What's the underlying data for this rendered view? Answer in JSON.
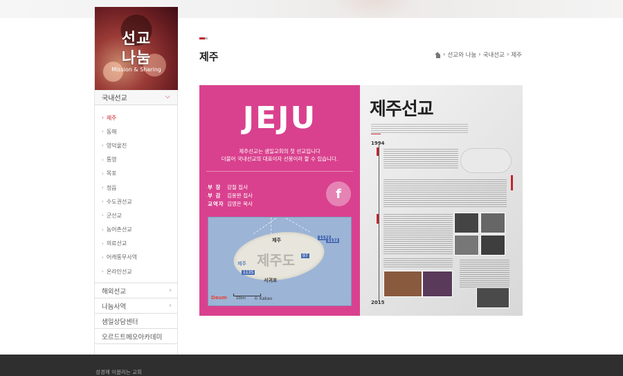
{
  "sidebar": {
    "hero": {
      "title1": "선교",
      "title2": "나눔",
      "subtitle": "Mission & Sharing"
    },
    "active_section": "국내선교",
    "submenu": [
      "제주",
      "동해",
      "영덕울진",
      "통영",
      "목포",
      "정읍",
      "수도권선교",
      "군선교",
      "농어촌선교",
      "의료선교",
      "어캐통무사역",
      "온라인선교"
    ],
    "other_sections": [
      "해외선교",
      "나눔사역",
      "샘일상담센터",
      "오르드트메오아카데미"
    ]
  },
  "main": {
    "title": "제주",
    "breadcrumb": [
      "선교와 나눔",
      "국내선교",
      "제주"
    ]
  },
  "banner": {
    "big_title": "JEJU",
    "desc_line1": "제주선교는 샘일교회의 첫 선교입니다",
    "desc_line2": "더불어 국내선교의 대표이자 선봉이라 할 수 있습니다.",
    "staff": [
      {
        "role": "부 장",
        "name": "강철 집사"
      },
      {
        "role": "부 감",
        "name": "김용완 집사"
      },
      {
        "role": "교역자",
        "name": "김영은 목사"
      }
    ],
    "facebook": "f",
    "map": {
      "label_north": "제주",
      "label_center": "제주도",
      "label_south": "서귀포",
      "label_west": "제주",
      "badges": [
        "1132",
        "97",
        "1135",
        "1132"
      ],
      "brand": "Daum",
      "copyright": "© Kakao",
      "scale": "10km"
    },
    "right_title": "제주선교",
    "years": [
      "1994",
      "2015"
    ]
  },
  "footer": {
    "text": "성경께 이끌리는 교회"
  }
}
